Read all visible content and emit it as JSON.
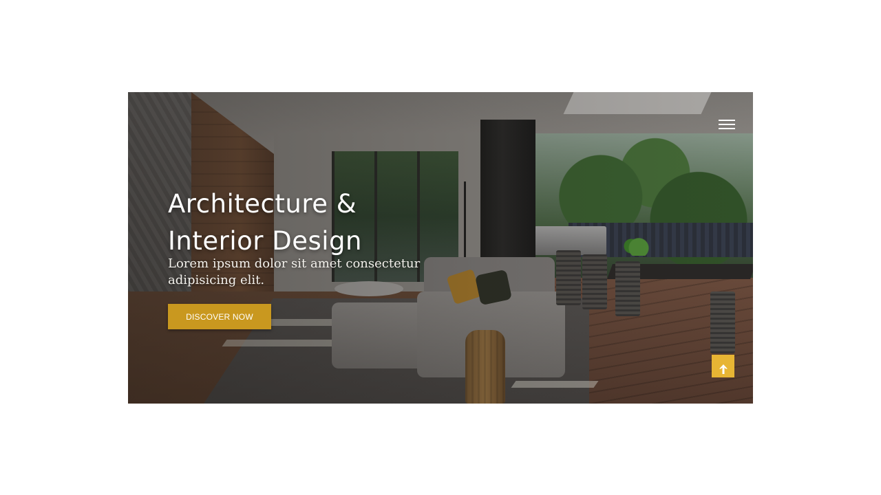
{
  "hero": {
    "title_line1": "Architecture &",
    "title_line2": "Interior Design",
    "subtitle_line1": "Lorem ipsum dolor sit amet consectetur",
    "subtitle_line2": "adipisicing elit.",
    "cta_label": "DISCOVER NOW"
  },
  "icons": {
    "menu": "hamburger-menu-icon",
    "scroll_top": "arrow-up-icon"
  },
  "colors": {
    "accent": "#c9981f",
    "scroll_top": "#e7b534",
    "text": "#ffffff"
  }
}
